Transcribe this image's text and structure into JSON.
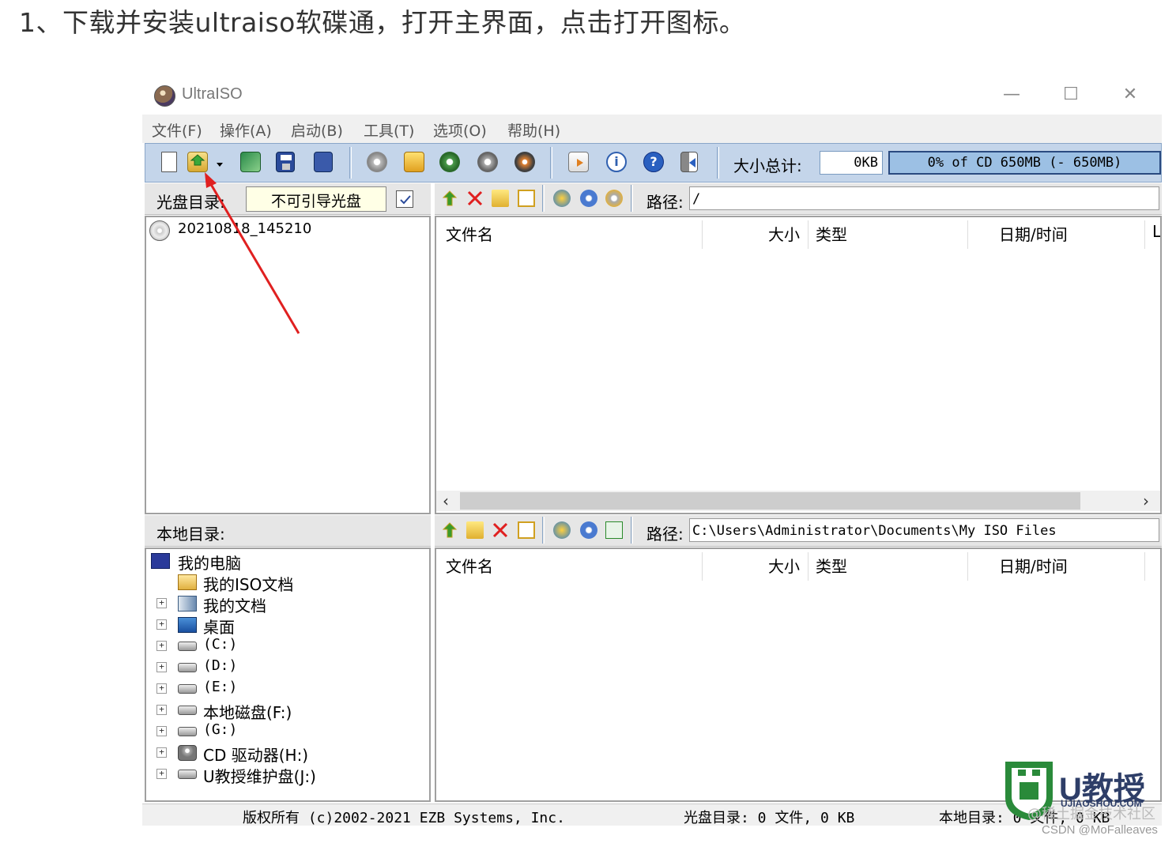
{
  "instruction": "1、下载并安装ultraiso软碟通，打开主界面，点击打开图标。",
  "window": {
    "title": "UltraISO",
    "controls": {
      "minimize": "—",
      "maximize": "☐",
      "close": "✕"
    }
  },
  "menu": [
    "文件(F)",
    "操作(A)",
    "启动(B)",
    "工具(T)",
    "选项(O)",
    "帮助(H)"
  ],
  "toolbar": {
    "size_total_label": "大小总计:",
    "size_total_value": "0KB",
    "capacity": "0% of CD 650MB (- 650MB)",
    "icons": [
      "new-icon",
      "open-icon",
      "dropdown-icon",
      "recycle-icon",
      "save-icon",
      "save-as-icon",
      "extract-icon",
      "burn-icon",
      "mount-icon",
      "virtual-drive-icon",
      "make-cd-image-icon",
      "properties-icon",
      "info-icon",
      "help-icon",
      "exit-icon"
    ]
  },
  "disc_pane": {
    "label": "光盘目录:",
    "disc_type": "不可引导光盘",
    "root_item": "20210818_145210",
    "path_label": "路径:",
    "path_value": "/",
    "columns": [
      "文件名",
      "大小",
      "类型",
      "日期/时间",
      "L"
    ]
  },
  "local_pane": {
    "label": "本地目录:",
    "path_label": "路径:",
    "path_value": "C:\\Users\\Administrator\\Documents\\My ISO Files",
    "columns": [
      "文件名",
      "大小",
      "类型",
      "日期/时间"
    ],
    "tree": [
      {
        "label": "我的电脑",
        "icon": "computer-icon"
      },
      {
        "label": "我的ISO文档",
        "icon": "iso-folder-icon"
      },
      {
        "label": "我的文档",
        "icon": "documents-icon"
      },
      {
        "label": "桌面",
        "icon": "desktop-icon"
      },
      {
        "label": "(C:)",
        "icon": "drive-icon"
      },
      {
        "label": "(D:)",
        "icon": "drive-icon"
      },
      {
        "label": "(E:)",
        "icon": "drive-icon"
      },
      {
        "label": "本地磁盘(F:)",
        "icon": "drive-icon"
      },
      {
        "label": "(G:)",
        "icon": "drive-icon"
      },
      {
        "label": "CD 驱动器(H:)",
        "icon": "cd-drive-icon"
      },
      {
        "label": "U教授维护盘(J:)",
        "icon": "drive-icon"
      }
    ]
  },
  "status": {
    "copyright": "版权所有 (c)2002-2021 EZB Systems, Inc.",
    "disc": "光盘目录: 0 文件, 0 KB",
    "local": "本地目录: 0 文件, 0 KB"
  },
  "watermark": {
    "brand": "U教授",
    "url": "UJIAOSHOU.COM",
    "community": "@稀土掘金技术社区",
    "csdn": "CSDN @MoFalleaves"
  },
  "colors": {
    "toolbar_bg": "#c4d5ea",
    "progress_bg": "#9cc0e4",
    "arrow": "#e02020",
    "brand": "#2e3e68",
    "brand_logo": "#2a8a3a"
  }
}
